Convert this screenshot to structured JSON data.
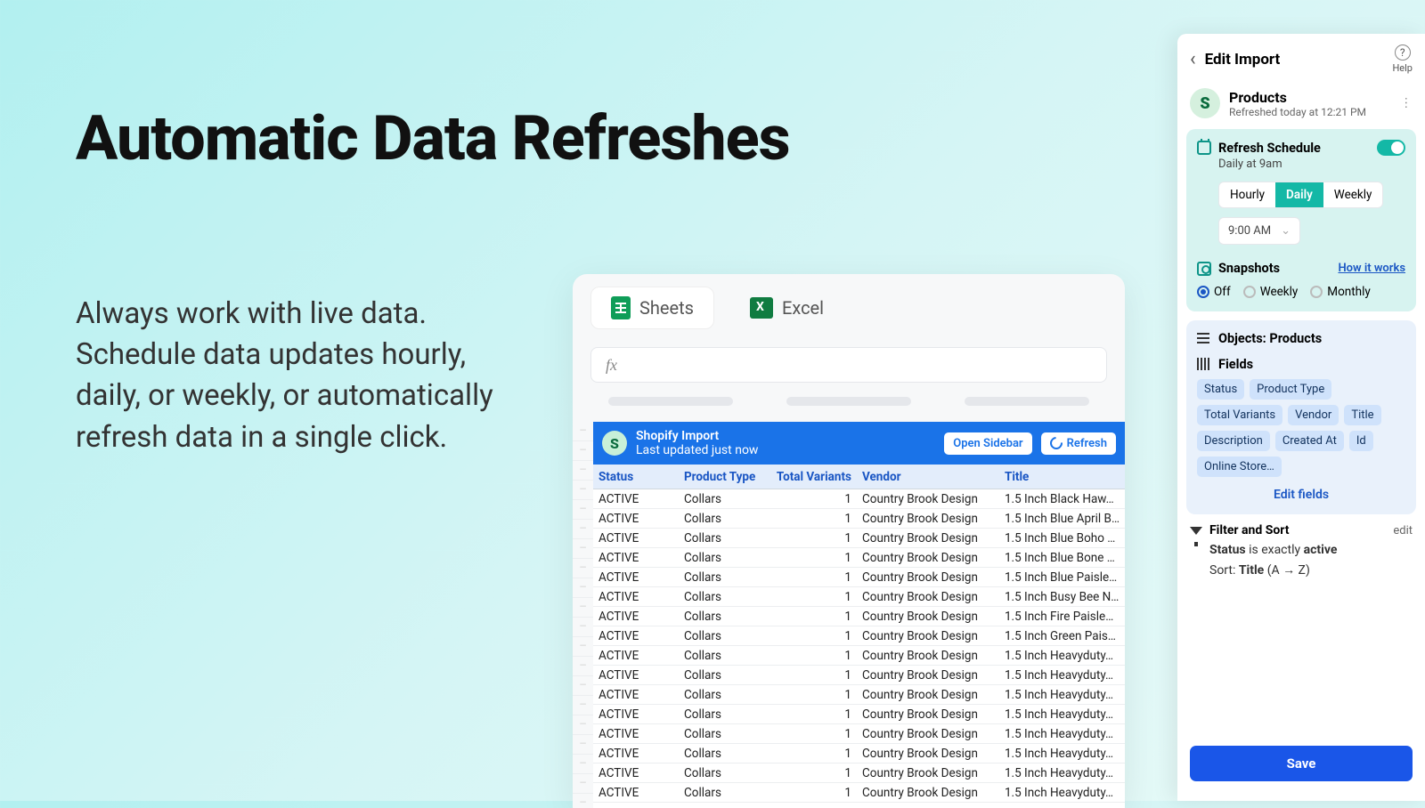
{
  "hero": {
    "headline": "Automatic Data Refreshes",
    "subhead": "Always work with live data. Schedule data updates hourly, daily, or weekly, or automatically refresh data in a single click."
  },
  "sheet": {
    "tabs": {
      "sheets": "Sheets",
      "excel": "Excel"
    },
    "fx": "fx",
    "import_bar": {
      "title": "Shopify Import",
      "subtitle": "Last updated just now",
      "open_sidebar": "Open Sidebar",
      "refresh": "Refresh"
    },
    "columns": [
      "Status",
      "Product Type",
      "Total Variants",
      "Vendor",
      "Title"
    ],
    "rows": [
      [
        "ACTIVE",
        "Collars",
        "1",
        "Country Brook Design",
        "1.5 Inch Black Haw…"
      ],
      [
        "ACTIVE",
        "Collars",
        "1",
        "Country Brook Design",
        "1.5 Inch Blue April B…"
      ],
      [
        "ACTIVE",
        "Collars",
        "1",
        "Country Brook Design",
        "1.5 Inch Blue Boho …"
      ],
      [
        "ACTIVE",
        "Collars",
        "1",
        "Country Brook Design",
        "1.5 Inch Blue Bone …"
      ],
      [
        "ACTIVE",
        "Collars",
        "1",
        "Country Brook Design",
        "1.5 Inch Blue Paisle…"
      ],
      [
        "ACTIVE",
        "Collars",
        "1",
        "Country Brook Design",
        "1.5 Inch Busy Bee N…"
      ],
      [
        "ACTIVE",
        "Collars",
        "1",
        "Country Brook Design",
        "1.5 Inch Fire Paisle…"
      ],
      [
        "ACTIVE",
        "Collars",
        "1",
        "Country Brook Design",
        "1.5 Inch Green Pais…"
      ],
      [
        "ACTIVE",
        "Collars",
        "1",
        "Country Brook Design",
        "1.5 Inch Heavyduty…"
      ],
      [
        "ACTIVE",
        "Collars",
        "1",
        "Country Brook Design",
        "1.5 Inch Heavyduty…"
      ],
      [
        "ACTIVE",
        "Collars",
        "1",
        "Country Brook Design",
        "1.5 Inch Heavyduty…"
      ],
      [
        "ACTIVE",
        "Collars",
        "1",
        "Country Brook Design",
        "1.5 Inch Heavyduty…"
      ],
      [
        "ACTIVE",
        "Collars",
        "1",
        "Country Brook Design",
        "1.5 Inch Heavyduty…"
      ],
      [
        "ACTIVE",
        "Collars",
        "1",
        "Country Brook Design",
        "1.5 Inch Heavyduty…"
      ],
      [
        "ACTIVE",
        "Collars",
        "1",
        "Country Brook Design",
        "1.5 Inch Heavyduty…"
      ],
      [
        "ACTIVE",
        "Collars",
        "1",
        "Country Brook Design",
        "1.5 Inch Heavyduty…"
      ]
    ]
  },
  "panel": {
    "header": {
      "title": "Edit Import",
      "help": "Help"
    },
    "product": {
      "title": "Products",
      "subtitle": "Refreshed today at 12:21 PM"
    },
    "refresh": {
      "title": "Refresh Schedule",
      "summary": "Daily at 9am",
      "options": [
        "Hourly",
        "Daily",
        "Weekly"
      ],
      "active": "Daily",
      "time": "9:00 AM"
    },
    "snapshots": {
      "title": "Snapshots",
      "how": "How it works",
      "options": [
        "Off",
        "Weekly",
        "Monthly"
      ],
      "active": "Off"
    },
    "objects": {
      "label": "Objects: Products"
    },
    "fields": {
      "label": "Fields",
      "chips": [
        "Status",
        "Product Type",
        "Total Variants",
        "Vendor",
        "Title",
        "Description",
        "Created At",
        "Id",
        "Online Store…"
      ],
      "edit": "Edit fields"
    },
    "filter": {
      "title": "Filter and Sort",
      "edit": "edit",
      "line1_a": "Status",
      "line1_b": " is exactly ",
      "line1_c": "active",
      "line2_a": "Sort: ",
      "line2_b": "Title",
      "line2_c": " (A → Z)"
    },
    "save": "Save"
  }
}
